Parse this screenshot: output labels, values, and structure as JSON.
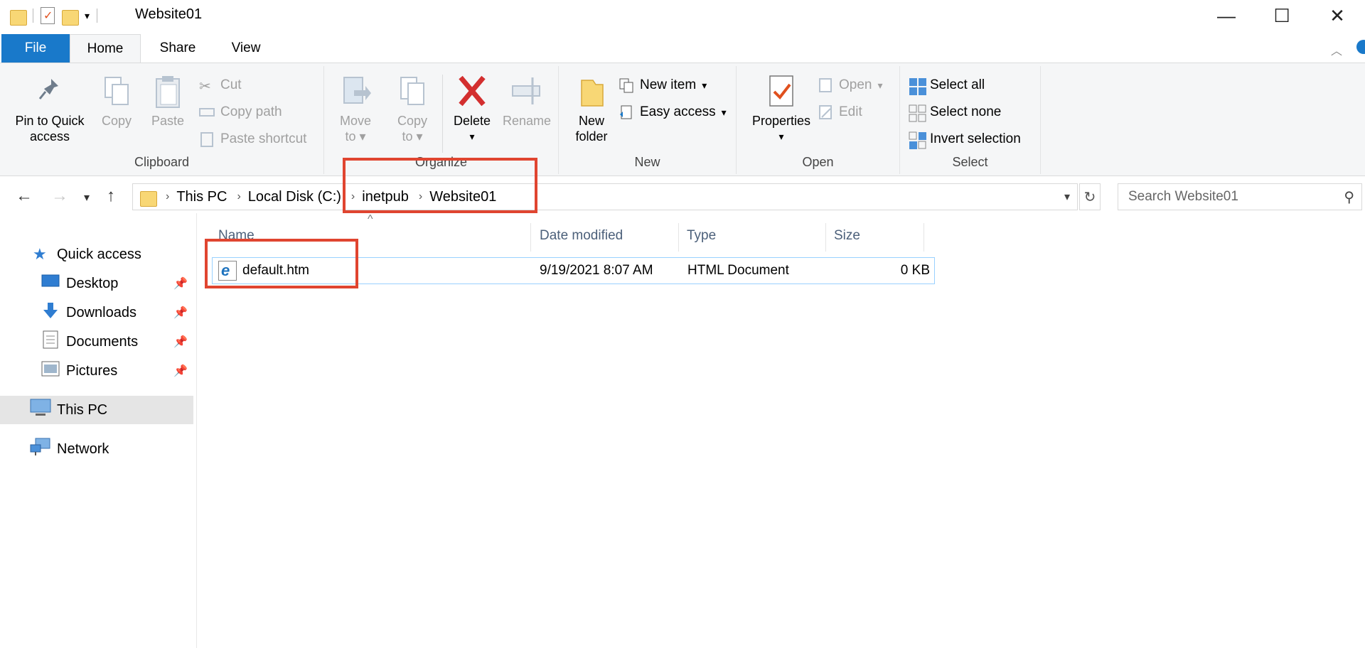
{
  "window": {
    "title": "Website01"
  },
  "ribbon_tabs": [
    "File",
    "Home",
    "Share",
    "View"
  ],
  "clipboard": {
    "pin_label_1": "Pin to Quick",
    "pin_label_2": "access",
    "copy": "Copy",
    "paste": "Paste",
    "cut": "Cut",
    "copy_path": "Copy path",
    "paste_shortcut": "Paste shortcut",
    "group": "Clipboard"
  },
  "organize": {
    "move_1": "Move",
    "move_2": "to",
    "copy_1": "Copy",
    "copy_2": "to",
    "delete": "Delete",
    "rename": "Rename",
    "group": "Organize"
  },
  "new_group": {
    "new_folder_1": "New",
    "new_folder_2": "folder",
    "new_item": "New item",
    "easy_access": "Easy access",
    "group": "New"
  },
  "open_group": {
    "properties": "Properties",
    "open": "Open",
    "edit": "Edit",
    "group": "Open"
  },
  "select_group": {
    "select_all": "Select all",
    "select_none": "Select none",
    "invert": "Invert selection",
    "group": "Select"
  },
  "address": {
    "crumbs": [
      "This PC",
      "Local Disk (C:)",
      "inetpub",
      "Website01"
    ],
    "search_placeholder": "Search Website01"
  },
  "sidebar": {
    "quick_access": "Quick access",
    "items": [
      "Desktop",
      "Downloads",
      "Documents",
      "Pictures"
    ],
    "this_pc": "This PC",
    "network": "Network"
  },
  "columns": [
    "Name",
    "Date modified",
    "Type",
    "Size"
  ],
  "files": [
    {
      "name": "default.htm",
      "date": "9/19/2021 8:07 AM",
      "type": "HTML Document",
      "size": "0 KB"
    }
  ],
  "colors": {
    "accent": "#1979ca",
    "highlight": "#e04530",
    "selection_border": "#99d1ff"
  }
}
